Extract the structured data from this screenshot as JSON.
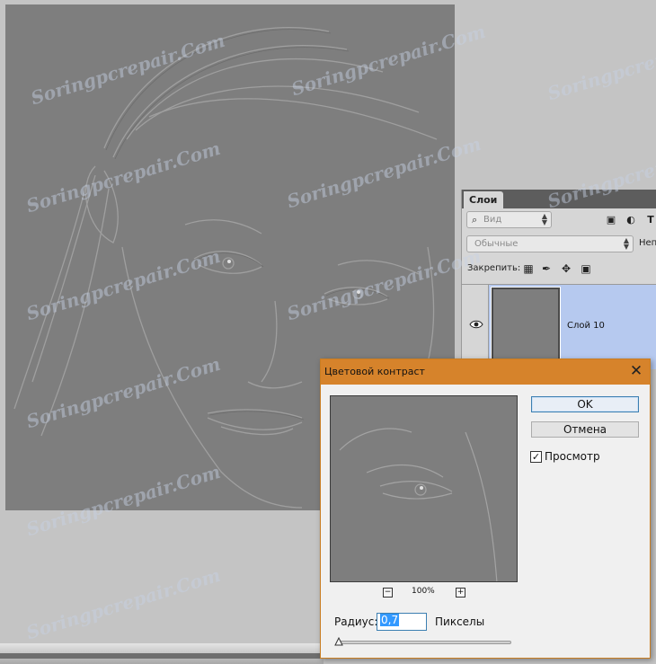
{
  "layers_panel": {
    "tab": "Слои",
    "filter": "Вид",
    "blend_mode": "Обычные",
    "opacity_label": "Непр",
    "lock_label": "Закрепить:",
    "layers": [
      {
        "name": "Слой 10",
        "visible": true,
        "selected": true
      }
    ]
  },
  "dialog": {
    "title": "Цветовой контраст",
    "ok_label": "OK",
    "cancel_label": "Отмена",
    "preview_label": "Просмотр",
    "preview_checked": true,
    "zoom": "100%",
    "zoom_out_symbol": "−",
    "zoom_in_symbol": "+",
    "radius_label": "Радиус:",
    "radius_value": "0,7",
    "radius_unit": "Пикселы",
    "radius_slider_fraction": 0.0
  },
  "watermark": "Soringpcrepair.Com",
  "colors": {
    "dialog_titlebar": "#d6832b",
    "selection_blue": "#b6c9ef",
    "canvas_gray": "#7e7e7e"
  }
}
